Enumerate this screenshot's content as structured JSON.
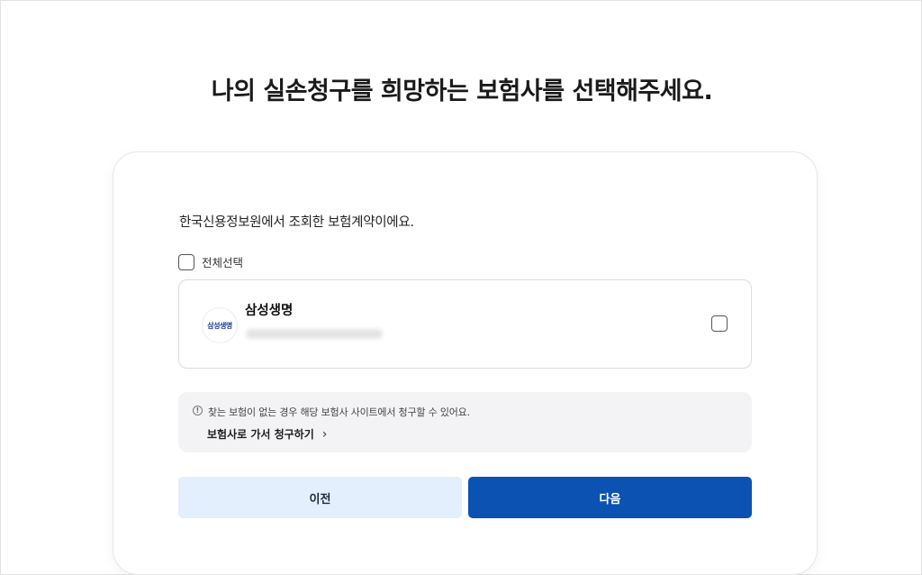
{
  "page": {
    "title": "나의 실손청구를 희망하는 보험사를 선택해주세요."
  },
  "card": {
    "subtitle": "한국신용정보원에서 조회한 보험계약이에요.",
    "select_all_label": "전체선택",
    "insurers": [
      {
        "logo_text": "삼성생명",
        "name": "삼성생명",
        "checked": false
      }
    ],
    "notice": {
      "icon": "info-icon",
      "text": "찾는 보험이 없는 경우 해당 보험사 사이트에서 청구할 수 있어요.",
      "link_label": "보험사로 가서 청구하기",
      "link_chevron": "›"
    },
    "buttons": {
      "prev_label": "이전",
      "next_label": "다음"
    }
  },
  "colors": {
    "primary": "#0b52b3",
    "secondary_button_bg": "#e3effd",
    "notice_bg": "#f3f3f5"
  }
}
